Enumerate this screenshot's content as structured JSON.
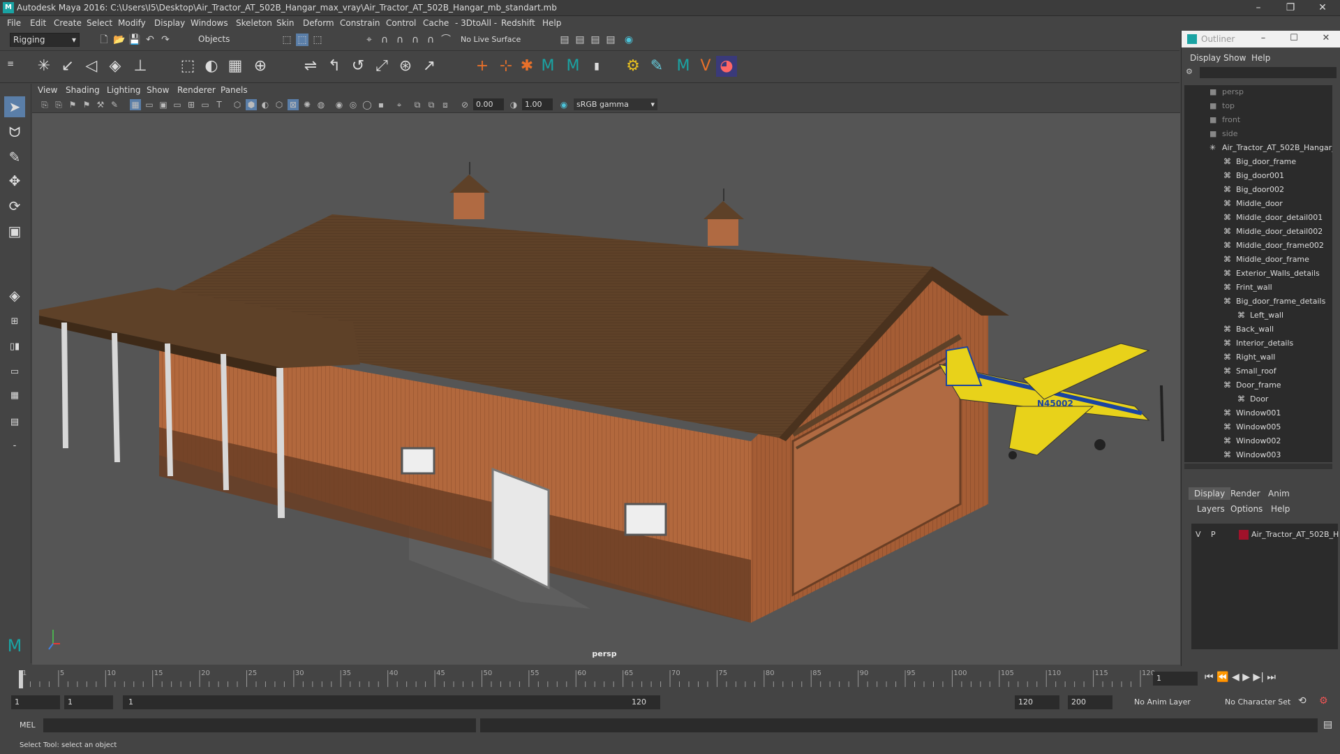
{
  "window": {
    "title": "Autodesk Maya 2016: C:\\Users\\I5\\Desktop\\Air_Tractor_AT_502B_Hangar_max_vray\\Air_Tractor_AT_502B_Hangar_mb_standart.mb"
  },
  "menubar": [
    "File",
    "Edit",
    "Create",
    "Select",
    "Modify",
    "Display",
    "Windows",
    "Skeleton",
    "Skin",
    "Deform",
    "Constrain",
    "Control",
    "Cache",
    "- 3DtoAll -",
    "Redshift",
    "Help"
  ],
  "statusline": {
    "mode": "Rigging",
    "select_mode": "Objects",
    "live_surface": "No Live Surface"
  },
  "panel_menu": [
    "View",
    "Shading",
    "Lighting",
    "Show",
    "Renderer",
    "Panels"
  ],
  "viewport_toolbar": {
    "exposure": "0.00",
    "gamma": "1.00",
    "colorspace": "sRGB gamma"
  },
  "viewport": {
    "camera_label": "persp",
    "plane_tailnumber": "N45002"
  },
  "timeline": {
    "ticks": [
      "1",
      "5",
      "10",
      "15",
      "20",
      "25",
      "30",
      "35",
      "40",
      "45",
      "50",
      "55",
      "60",
      "65",
      "70",
      "75",
      "80",
      "85",
      "90",
      "95",
      "100",
      "105",
      "110",
      "115",
      "120"
    ],
    "current_frame": "1"
  },
  "range": {
    "start": "1",
    "inner_start": "1",
    "slider_start": "1",
    "slider_end": "120",
    "end": "120",
    "max_end": "200",
    "anim_layer": "No Anim Layer",
    "character_set": "No Character Set"
  },
  "cmdline": {
    "label": "MEL"
  },
  "helpline": {
    "text": "Select Tool: select an object"
  },
  "outliner": {
    "title": "Outliner",
    "menu": [
      "Display",
      "Show",
      "Help"
    ],
    "items": [
      {
        "label": "persp",
        "type": "camera",
        "indent": 0
      },
      {
        "label": "top",
        "type": "camera",
        "indent": 0
      },
      {
        "label": "front",
        "type": "camera",
        "indent": 0
      },
      {
        "label": "side",
        "type": "camera",
        "indent": 0
      },
      {
        "label": "Air_Tractor_AT_502B_Hangar_",
        "type": "group",
        "indent": 0
      },
      {
        "label": "Big_door_frame",
        "type": "mesh",
        "indent": 1
      },
      {
        "label": "Big_door001",
        "type": "mesh",
        "indent": 1
      },
      {
        "label": "Big_door002",
        "type": "mesh",
        "indent": 1
      },
      {
        "label": "Middle_door",
        "type": "mesh",
        "indent": 1
      },
      {
        "label": "Middle_door_detail001",
        "type": "mesh",
        "indent": 1
      },
      {
        "label": "Middle_door_detail002",
        "type": "mesh",
        "indent": 1
      },
      {
        "label": "Middle_door_frame002",
        "type": "mesh",
        "indent": 1
      },
      {
        "label": "Middle_door_frame",
        "type": "mesh",
        "indent": 1
      },
      {
        "label": "Exterior_Walls_details",
        "type": "mesh",
        "indent": 1
      },
      {
        "label": "Frint_wall",
        "type": "mesh",
        "indent": 1
      },
      {
        "label": "Big_door_frame_details",
        "type": "mesh",
        "indent": 1
      },
      {
        "label": "Left_wall",
        "type": "mesh",
        "indent": 2
      },
      {
        "label": "Back_wall",
        "type": "mesh",
        "indent": 1
      },
      {
        "label": "Interior_details",
        "type": "mesh",
        "indent": 1
      },
      {
        "label": "Right_wall",
        "type": "mesh",
        "indent": 1
      },
      {
        "label": "Small_roof",
        "type": "mesh",
        "indent": 1
      },
      {
        "label": "Door_frame",
        "type": "mesh",
        "indent": 1
      },
      {
        "label": "Door",
        "type": "mesh",
        "indent": 2
      },
      {
        "label": "Window001",
        "type": "mesh",
        "indent": 1
      },
      {
        "label": "Window005",
        "type": "mesh",
        "indent": 1
      },
      {
        "label": "Window002",
        "type": "mesh",
        "indent": 1
      },
      {
        "label": "Window003",
        "type": "mesh",
        "indent": 1
      }
    ]
  },
  "layer_editor": {
    "tabs": [
      "Display",
      "Render",
      "Anim"
    ],
    "menu": [
      "Layers",
      "Options",
      "Help"
    ],
    "layers": [
      {
        "v": "V",
        "p": "P",
        "name": "Air_Tractor_AT_502B_H",
        "color": "#a0122a"
      }
    ]
  }
}
